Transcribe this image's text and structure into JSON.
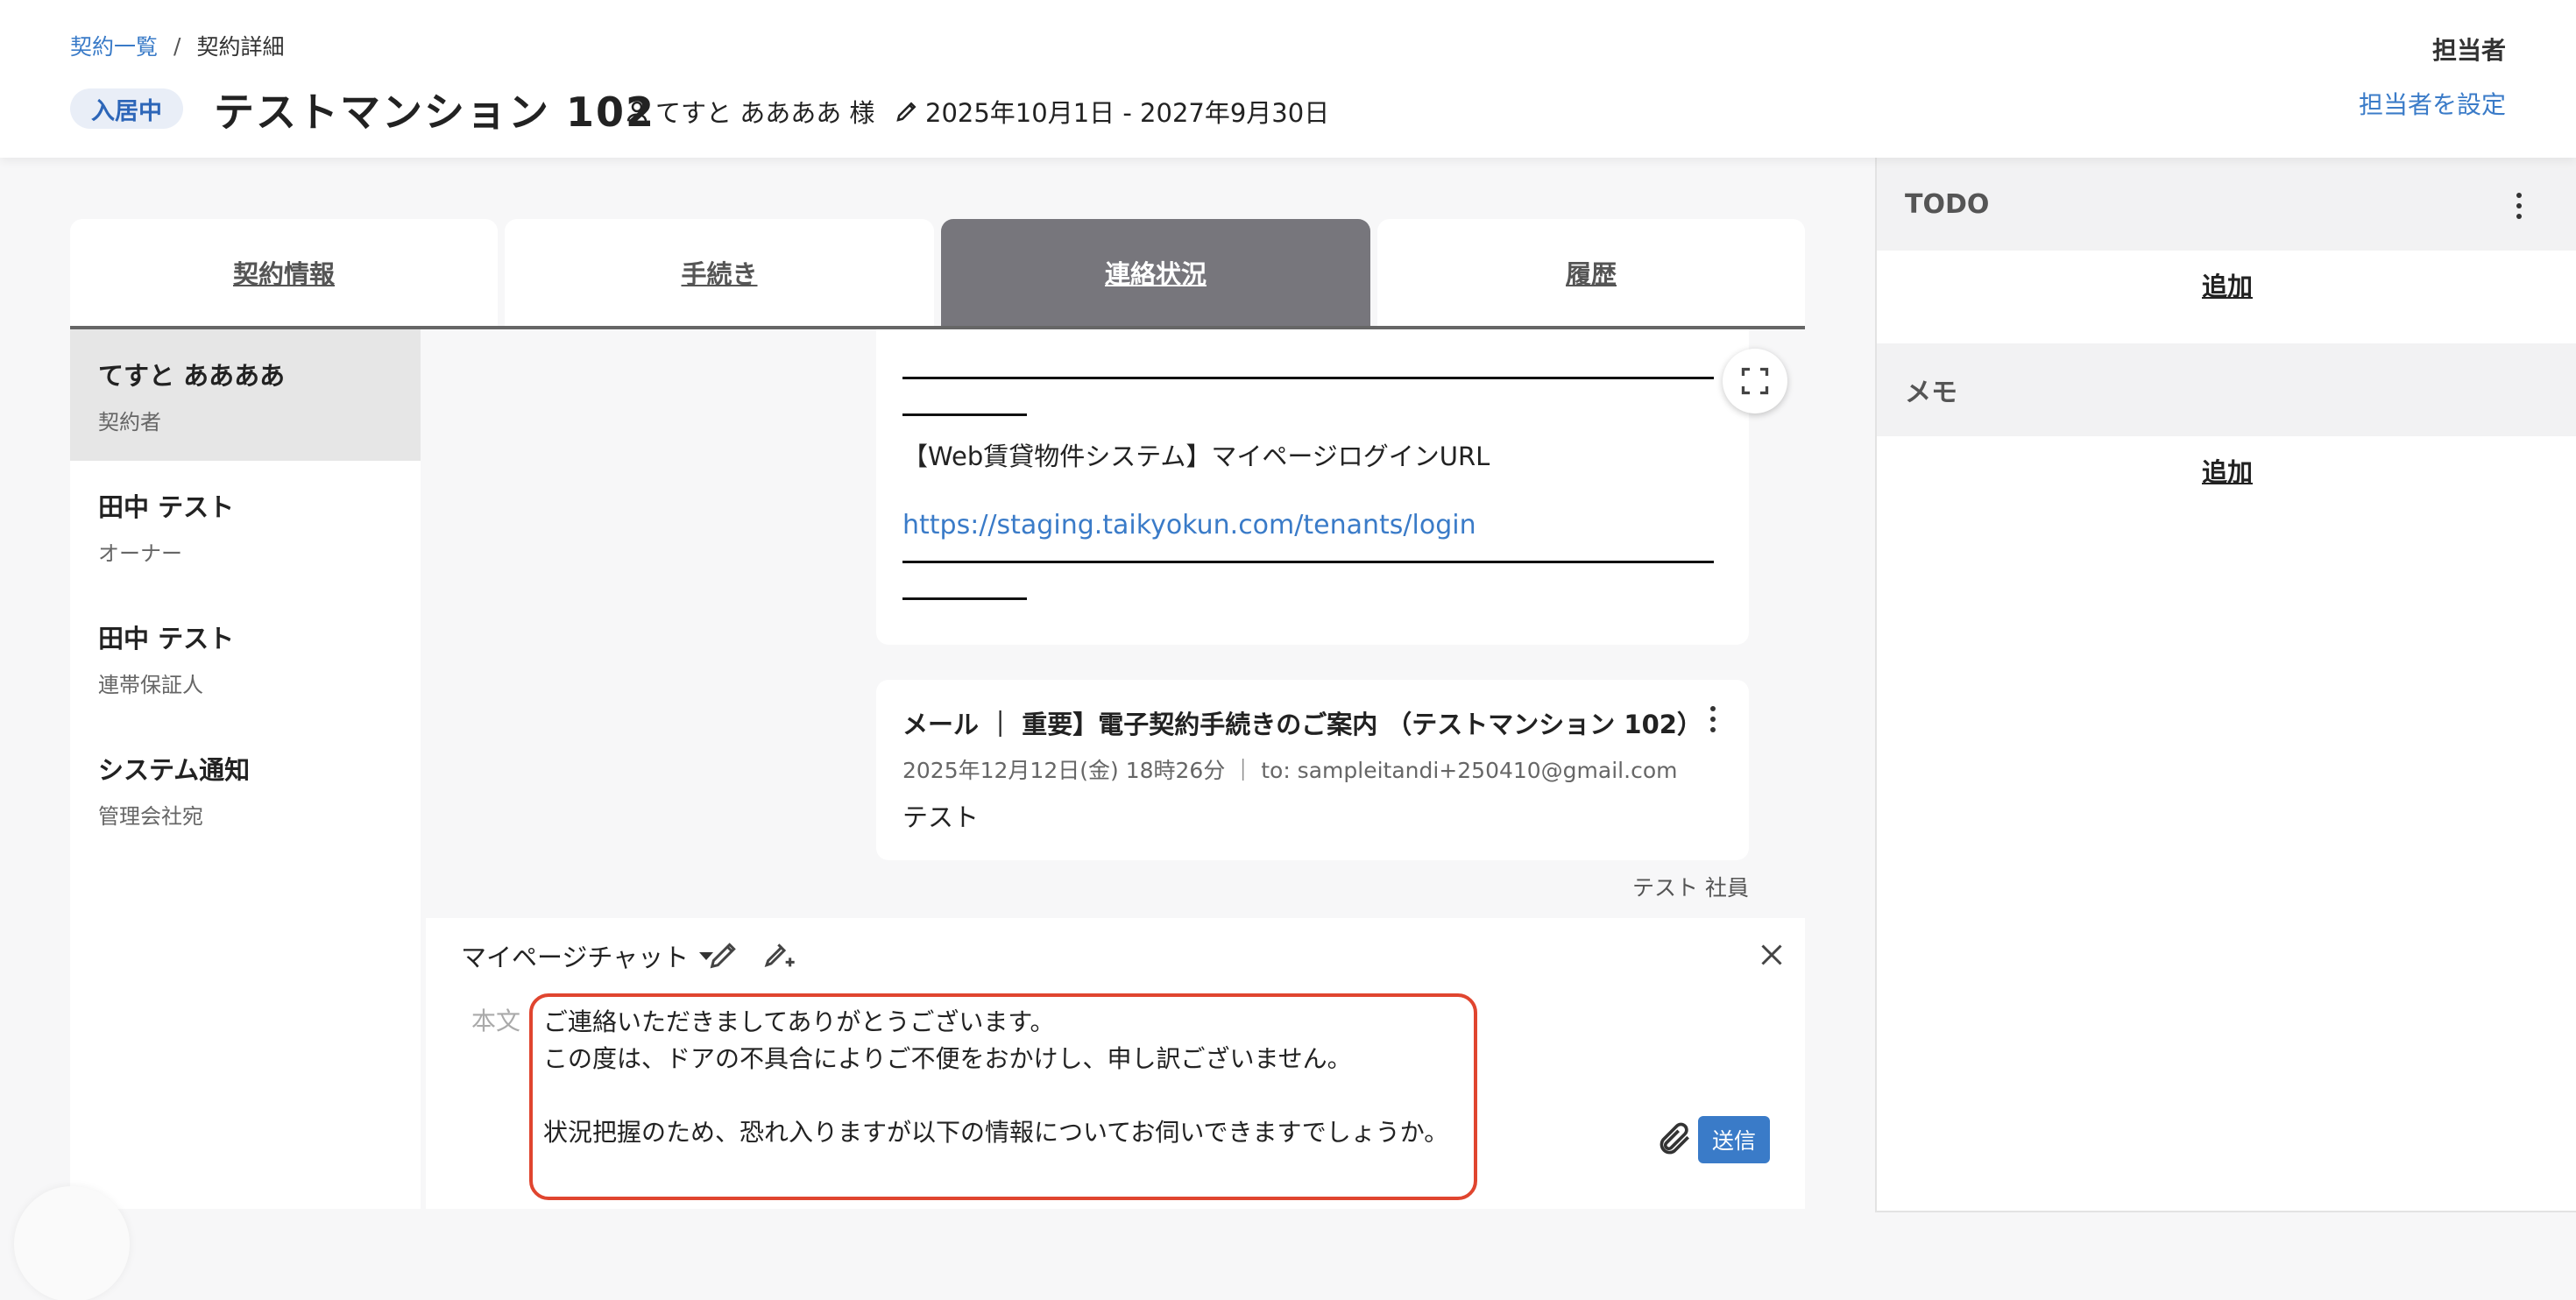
{
  "header": {
    "breadcrumb": {
      "parent": "契約一覧",
      "separator": "/",
      "current": "契約詳細"
    },
    "status_badge": "入居中",
    "title": "テストマンション 102",
    "tenant": "てすと ああああ 様",
    "period": "2025年10月1日 - 2027年9月30日",
    "assignee_label": "担当者",
    "assignee_link": "担当者を設定"
  },
  "tabs": [
    {
      "label": "契約情報",
      "active": false
    },
    {
      "label": "手続き",
      "active": false
    },
    {
      "label": "連絡状況",
      "active": true
    },
    {
      "label": "履歴",
      "active": false
    }
  ],
  "contacts": [
    {
      "name": "てすと ああああ",
      "role": "契約者",
      "active": true
    },
    {
      "name": "田中 テスト",
      "role": "オーナー",
      "active": false
    },
    {
      "name": "田中 テスト",
      "role": "連帯保証人",
      "active": false
    },
    {
      "name": "システム通知",
      "role": "管理会社宛",
      "active": false
    }
  ],
  "messages": {
    "first": {
      "text": "【Web賃貸物件システム】マイページログインURL",
      "link": "https://staging.taikyokun.com/tenants/login"
    },
    "second": {
      "subject": "メール ｜ 重要】電子契約手続きのご案内 （テストマンション 102）",
      "meta": "2025年12月12日(金) 18時26分 ｜ to: sampleitandi+250410@gmail.com",
      "body": "テスト",
      "sender": "テスト 社員"
    }
  },
  "composer": {
    "channel": "マイページチャット",
    "body_label": "本文",
    "body_text": "ご連絡いただきましてありがとうございます。\nこの度は、ドアの不具合によりご不便をおかけし、申し訳ございません。\n\n状況把握のため、恐れ入りますが以下の情報についてお伺いできますでしょうか。",
    "send_label": "送信"
  },
  "sidebar": {
    "todo_title": "TODO",
    "todo_add": "追加",
    "memo_title": "メモ",
    "memo_add": "追加"
  },
  "icons": {
    "tenant": "person-icon",
    "period": "pen-icon",
    "expand": "expand-icon",
    "more": "kebab-icon",
    "edit": "pencil-icon",
    "ai_edit": "pencil-sparkle-icon",
    "close": "close-icon",
    "attach": "paperclip-icon"
  },
  "colors": {
    "accent": "#3a7bc8",
    "active_tab": "#77767c",
    "highlight_border": "#e0452f",
    "badge_bg": "#e9eef7"
  }
}
